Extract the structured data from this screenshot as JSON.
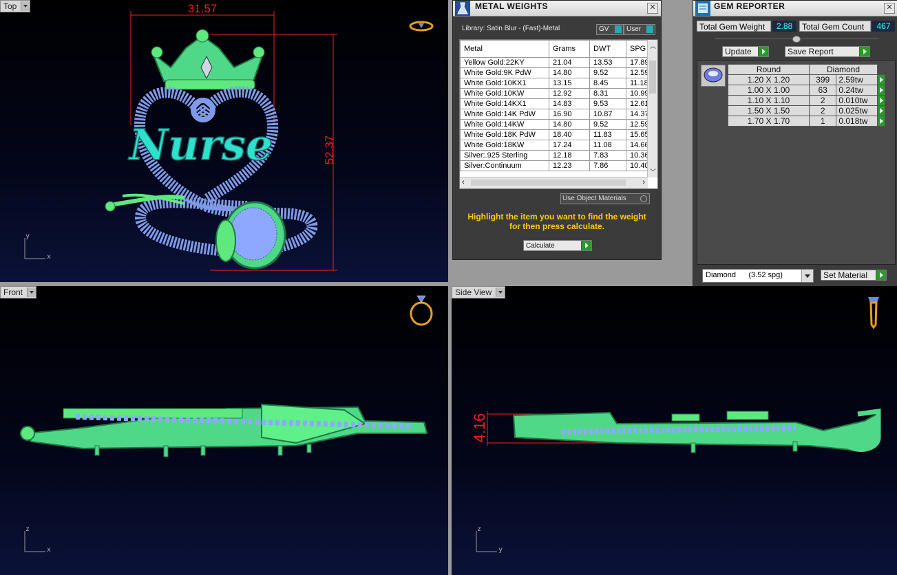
{
  "viewports": {
    "top": {
      "label": "Top",
      "dim_width": "31.57",
      "dim_height": "52.37",
      "axis_v": "y",
      "axis_h": "x",
      "text": "Nurse"
    },
    "front": {
      "label": "Front",
      "axis_v": "z",
      "axis_h": "x"
    },
    "side": {
      "label": "Side View",
      "dim_thickness": "4.16",
      "axis_v": "z",
      "axis_h": "y"
    }
  },
  "metal_weights": {
    "title": "METAL WEIGHTS",
    "library": "Library: Satin Blur - (Fast)-Metal",
    "toggle_gv": "GV",
    "toggle_user": "User",
    "columns": [
      "Metal",
      "Grams",
      "DWT",
      "SPG"
    ],
    "rows": [
      [
        "Yellow Gold:22KY",
        "21.04",
        "13.53",
        "17.89"
      ],
      [
        "White Gold:9K PdW",
        "14.80",
        "9.52",
        "12.59"
      ],
      [
        "White Gold:10KX1",
        "13.15",
        "8.45",
        "11.18"
      ],
      [
        "White Gold:10KW",
        "12.92",
        "8.31",
        "10.99"
      ],
      [
        "White Gold:14KX1",
        "14.83",
        "9.53",
        "12.61"
      ],
      [
        "White Gold:14K PdW",
        "16.90",
        "10.87",
        "14.37"
      ],
      [
        "White Gold:14KW",
        "14.80",
        "9.52",
        "12.59"
      ],
      [
        "White Gold:18K PdW",
        "18.40",
        "11.83",
        "15.65"
      ],
      [
        "White Gold:18KW",
        "17.24",
        "11.08",
        "14.66"
      ],
      [
        "Silver:.925 Sterling",
        "12.18",
        "7.83",
        "10.36"
      ],
      [
        "Silver:Continuum",
        "12.23",
        "7.86",
        "10.40"
      ]
    ],
    "use_object_materials": "Use Object Materials",
    "hint": "Highlight the item you want to find the weight for then press calculate.",
    "calculate": "Calculate"
  },
  "gem_reporter": {
    "title": "GEM REPORTER",
    "total_weight_label": "Total Gem Weight",
    "total_weight": "2.88",
    "total_count_label": "Total Gem Count",
    "total_count": "467",
    "update": "Update",
    "save_report": "Save Report",
    "header_shape": "Round",
    "header_material": "Diamond",
    "rows": [
      [
        "1.20 X 1.20",
        "399",
        "2.59tw"
      ],
      [
        "1.00 X 1.00",
        "63",
        "0.24tw"
      ],
      [
        "1.10 X 1.10",
        "2",
        "0.010tw"
      ],
      [
        "1.50 X 1.50",
        "2",
        "0.025tw"
      ],
      [
        "1.70 X 1.70",
        "1",
        "0.018tw"
      ]
    ],
    "material_select": "Diamond      (3.52 spg)",
    "set_material": "Set Material"
  },
  "colors": {
    "metal": "#5fe87e",
    "gem": "#8fa8ff",
    "dimension": "#ff1a1a",
    "hint": "#ffcc00"
  }
}
